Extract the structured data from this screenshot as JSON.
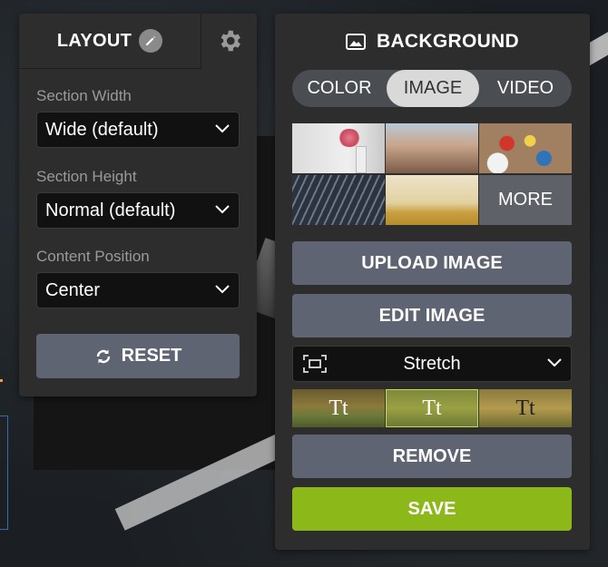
{
  "layout_panel": {
    "tab_label": "LAYOUT",
    "fields": [
      {
        "label": "Section Width",
        "value": "Wide (default)"
      },
      {
        "label": "Section Height",
        "value": "Normal (default)"
      },
      {
        "label": "Content Position",
        "value": "Center"
      }
    ],
    "reset_label": "RESET"
  },
  "background_panel": {
    "title": "BACKGROUND",
    "tabs": [
      "COLOR",
      "IMAGE",
      "VIDEO"
    ],
    "active_tab": "IMAGE",
    "more_label": "MORE",
    "upload_label": "UPLOAD IMAGE",
    "edit_label": "EDIT IMAGE",
    "fit_value": "Stretch",
    "text_styles": [
      "Tt",
      "Tt",
      "Tt"
    ],
    "remove_label": "REMOVE",
    "save_label": "SAVE"
  },
  "colors": {
    "panel": "#2d2d2d",
    "button": "#5f6472",
    "save": "#8db81a",
    "selected_style_border": "#c7dd4f"
  }
}
